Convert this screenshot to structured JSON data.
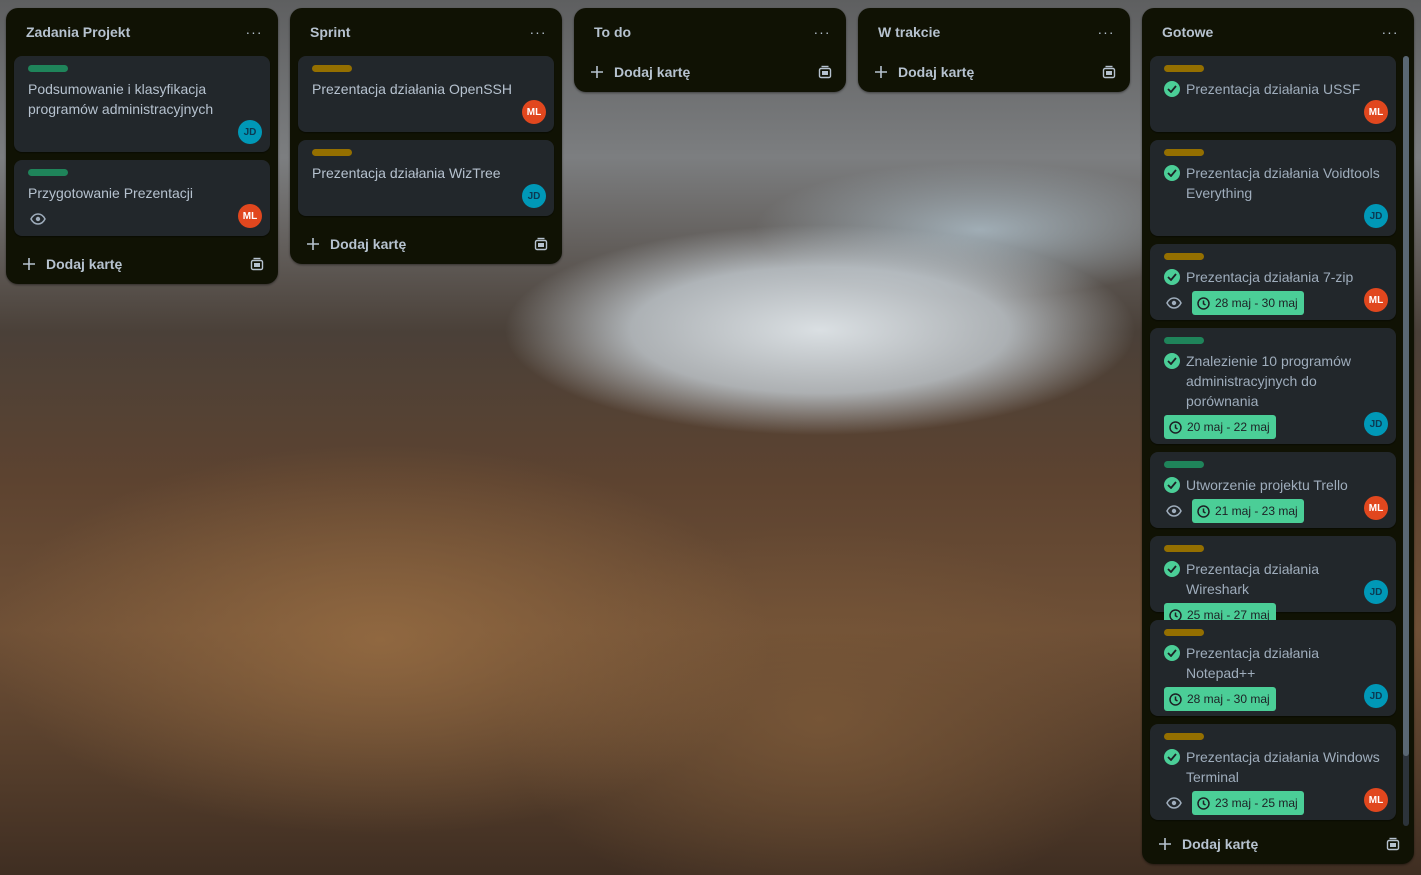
{
  "lists": [
    {
      "title": "Zadania Projekt",
      "menu": "···",
      "add_label": "Dodaj kartę",
      "cards": [
        {
          "label": "green",
          "title": "Podsumowanie i klasyfikacja programów administracyjnych",
          "avatar": "JD"
        },
        {
          "label": "green",
          "title": "Przygotowanie Prezentacji",
          "avatar": "ML",
          "watch": true
        }
      ]
    },
    {
      "title": "Sprint",
      "menu": "···",
      "add_label": "Dodaj kartę",
      "cards": [
        {
          "label": "yellow",
          "title": "Prezentacja działania OpenSSH",
          "avatar": "ML"
        },
        {
          "label": "yellow",
          "title": "Prezentacja działania WizTree",
          "avatar": "JD"
        }
      ]
    },
    {
      "title": "To do",
      "menu": "···",
      "add_label": "Dodaj kartę",
      "cards": []
    },
    {
      "title": "W trakcie",
      "menu": "···",
      "add_label": "Dodaj kartę",
      "cards": []
    },
    {
      "title": "Gotowe",
      "menu": "···",
      "add_label": "Dodaj kartę",
      "cards": [
        {
          "label": "yellow",
          "title": "Prezentacja działania USSF",
          "avatar": "ML",
          "done": true
        },
        {
          "label": "yellow",
          "title": "Prezentacja działania Voidtools Everything",
          "avatar": "JD",
          "done": true
        },
        {
          "label": "yellow",
          "title": "Prezentacja działania 7-zip",
          "avatar": "ML",
          "done": true,
          "watch": true,
          "date": "28 maj - 30 maj"
        },
        {
          "label": "green",
          "title": "Znalezienie 10 programów administracyjnych do porównania",
          "avatar": "JD",
          "done": true,
          "date": "20 maj - 22 maj"
        },
        {
          "label": "green",
          "title": "Utworzenie projektu Trello",
          "avatar": "ML",
          "done": true,
          "watch": true,
          "date": "21 maj - 23 maj"
        },
        {
          "label": "yellow",
          "title": "Prezentacja działania Wireshark",
          "avatar": "JD",
          "done": true,
          "date": "25 maj - 27 maj"
        },
        {
          "label": "yellow",
          "title": "Prezentacja działania Notepad++",
          "avatar": "JD",
          "done": true,
          "date": "28 maj - 30 maj"
        },
        {
          "label": "yellow",
          "title": "Prezentacja działania Windows Terminal",
          "avatar": "ML",
          "done": true,
          "watch": true,
          "date": "23 maj - 25 maj"
        }
      ]
    }
  ],
  "colors": {
    "list_bg": "#101204",
    "card_bg": "#22272b",
    "label_green": "#1f845a",
    "label_yellow": "#946f00",
    "date_badge": "#4bce97",
    "avatar_jd": "#0098b7",
    "avatar_ml": "#e1471e"
  },
  "icons": {
    "list_menu": "ellipsis-icon",
    "add": "plus-icon",
    "template": "card-template-icon",
    "watch": "eye-icon",
    "done": "check-circle-icon",
    "date": "clock-icon"
  }
}
